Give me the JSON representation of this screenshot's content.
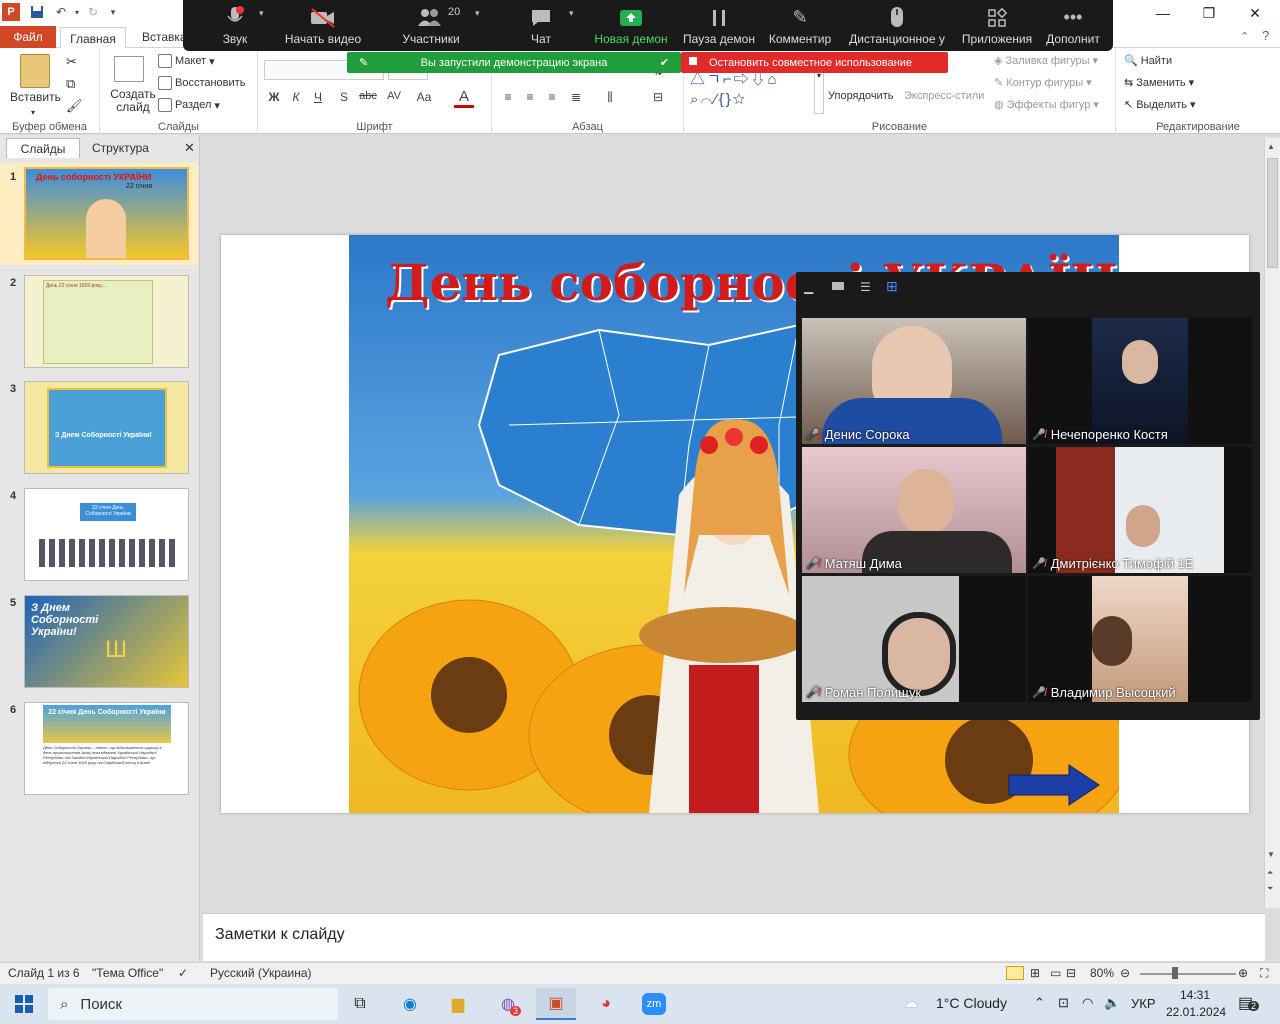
{
  "window": {
    "minimize": "—",
    "maximize": "❐",
    "close": "✕"
  },
  "tabs": {
    "file": "Файл",
    "home": "Главная",
    "insert": "Вставка"
  },
  "ribbon": {
    "clipboard": {
      "paste": "Вставить",
      "label": "Буфер обмена"
    },
    "slides": {
      "new_slide": "Создать слайд",
      "layout": "Макет",
      "reset": "Восстановить",
      "section": "Раздел",
      "label": "Слайды"
    },
    "font": {
      "label": "Шрифт",
      "bold": "Ж",
      "italic": "К",
      "underline": "Ч",
      "shadow": "S",
      "strike": "abc",
      "spacing": "AV",
      "case": "Aa",
      "color": "A"
    },
    "paragraph": {
      "label": "Абзац"
    },
    "drawing": {
      "arrange": "Упорядочить",
      "quick_styles": "Экспресс-стили",
      "fill": "Заливка фигуры",
      "outline": "Контур фигуры",
      "effects": "Эффекты фигур",
      "label": "Рисование"
    },
    "editing": {
      "find": "Найти",
      "replace": "Заменить",
      "select": "Выделить",
      "label": "Редактирование"
    }
  },
  "zoom_toolbar": {
    "items": [
      {
        "label": "Звук",
        "icon": "mic-muted-icon"
      },
      {
        "label": "Начать видео",
        "icon": "video-off-icon"
      },
      {
        "label": "Участники",
        "icon": "participants-icon",
        "count": "20"
      },
      {
        "label": "Чат",
        "icon": "chat-icon"
      },
      {
        "label": "Новая демон",
        "icon": "share-screen-icon"
      },
      {
        "label": "Пауза демон",
        "icon": "pause-icon"
      },
      {
        "label": "Комментир",
        "icon": "pen-icon"
      },
      {
        "label": "Дистанционное у",
        "icon": "mouse-icon"
      },
      {
        "label": "Приложения",
        "icon": "apps-icon"
      },
      {
        "label": "Дополнит",
        "icon": "more-icon"
      }
    ],
    "sharing_notice": "Вы запустили демонстрацию экрана",
    "stop_share": "Остановить совместное использование"
  },
  "left_pane": {
    "tabs": {
      "slides": "Слайды",
      "outline": "Структура",
      "close": "✕"
    },
    "slides": [
      {
        "num": "1",
        "title": "День соборності УКРАЇНИ",
        "sub": "22 січня"
      },
      {
        "num": "2",
        "title": "День 22 січня 1919 року..."
      },
      {
        "num": "3",
        "title": "З Днем Соборності України!"
      },
      {
        "num": "4",
        "title": "22 січня День Соборності України"
      },
      {
        "num": "5",
        "title": "З Днем Соборності України!"
      },
      {
        "num": "6",
        "title": "22 січня День Соборності України",
        "body": "День Соборності України – свято, що відзначається щороку в день проголошення Акту возз'єднання Української Народної Республіки та Західно-Української Народної Республіки, що відбулося 22 січня 1919 року на Софійській площі в Києві."
      }
    ]
  },
  "slide": {
    "title": "День соборності УКРАЇНИ"
  },
  "gallery": {
    "participants": [
      {
        "name": "Денис Сорока"
      },
      {
        "name": "Нечепоренко Костя"
      },
      {
        "name": "Матяш Дима"
      },
      {
        "name": "Дмитрієнко Тимофій 1Е"
      },
      {
        "name": "Роман Полищук"
      },
      {
        "name": "Владимир Высоцкий"
      }
    ]
  },
  "notes": {
    "placeholder": "Заметки к слайду"
  },
  "status": {
    "slide_info": "Слайд 1 из 6",
    "theme": "\"Тема Office\"",
    "language": "Русский (Украина)",
    "zoom": "80%"
  },
  "taskbar": {
    "search": "Поиск",
    "weather": "1°C  Cloudy",
    "lang": "УКР",
    "time": "14:31",
    "date": "22.01.2024",
    "viber_badge": "3",
    "notif_count": "2"
  },
  "colors": {
    "accent_file": "#d24726",
    "share_green": "#1f9e3b",
    "stop_red": "#e22a2a"
  }
}
